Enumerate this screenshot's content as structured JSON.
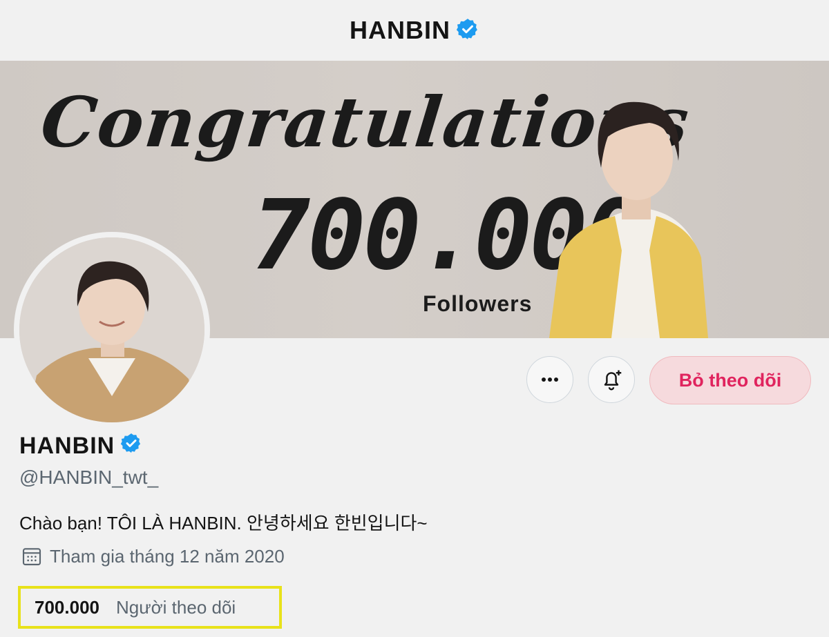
{
  "header": {
    "title": "HANBIN"
  },
  "banner": {
    "headline": "Congratulations",
    "number": "700.000",
    "subtitle": "Followers"
  },
  "actions": {
    "more_icon": "more-horizontal-icon",
    "notify_icon": "bell-plus-icon",
    "unfollow_label": "Bỏ theo dõi"
  },
  "profile": {
    "name": "HANBIN",
    "handle": "@HANBIN_twt_",
    "bio": "Chào bạn! TÔI LÀ HANBIN. 안녕하세요 한빈입니다~",
    "joined": "Tham gia tháng 12 năm 2020",
    "followers_count": "700.000",
    "followers_label": "Người theo dõi"
  },
  "colors": {
    "verified": "#1d9bf0",
    "unfollow_text": "#e0245e",
    "highlight": "#e8e21a"
  }
}
